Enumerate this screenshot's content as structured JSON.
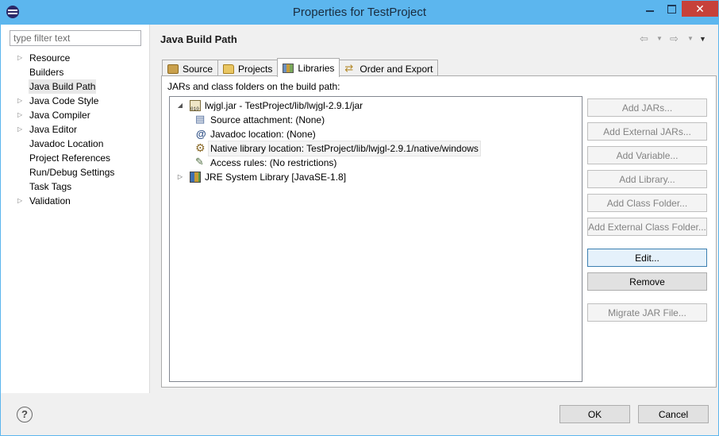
{
  "window": {
    "title": "Properties for TestProject",
    "close_glyph": "✕"
  },
  "filter": {
    "placeholder": "type filter text",
    "value": ""
  },
  "nav": {
    "items": [
      {
        "label": "Resource",
        "expandable": true
      },
      {
        "label": "Builders",
        "expandable": false
      },
      {
        "label": "Java Build Path",
        "expandable": false,
        "selected": true
      },
      {
        "label": "Java Code Style",
        "expandable": true
      },
      {
        "label": "Java Compiler",
        "expandable": true
      },
      {
        "label": "Java Editor",
        "expandable": true
      },
      {
        "label": "Javadoc Location",
        "expandable": false
      },
      {
        "label": "Project References",
        "expandable": false
      },
      {
        "label": "Run/Debug Settings",
        "expandable": false
      },
      {
        "label": "Task Tags",
        "expandable": false
      },
      {
        "label": "Validation",
        "expandable": true
      }
    ]
  },
  "page": {
    "title": "Java Build Path",
    "history": {
      "back": "⇦",
      "forward": "⇨",
      "dropdown": "▼",
      "menu": "▼"
    }
  },
  "tabs": [
    {
      "label": "Source",
      "icon": "source-folder-icon"
    },
    {
      "label": "Projects",
      "icon": "project-folder-icon"
    },
    {
      "label": "Libraries",
      "icon": "libraries-icon",
      "active": true
    },
    {
      "label": "Order and Export",
      "icon": "order-export-icon"
    }
  ],
  "libraries": {
    "heading": "JARs and class folders on the build path:",
    "tree": {
      "jar": {
        "label": "lwjgl.jar - TestProject/lib/lwjgl-2.9.1/jar",
        "expanded": true,
        "twisty": "◢",
        "children": [
          {
            "label": "Source attachment: (None)",
            "icon": "source-attachment-icon"
          },
          {
            "label": "Javadoc location: (None)",
            "icon": "javadoc-icon"
          },
          {
            "label": "Native library location: TestProject/lib/lwjgl-2.9.1/native/windows",
            "icon": "native-library-icon",
            "highlighted": true
          },
          {
            "label": "Access rules: (No restrictions)",
            "icon": "access-rules-icon"
          }
        ]
      },
      "jre": {
        "label": "JRE System Library [JavaSE-1.8]",
        "expanded": false,
        "twisty": "▷"
      }
    },
    "buttons": {
      "add_jars": "Add JARs...",
      "add_external_jars": "Add External JARs...",
      "add_variable": "Add Variable...",
      "add_library": "Add Library...",
      "add_class_folder": "Add Class Folder...",
      "add_external_class_folder": "Add External Class Folder...",
      "edit": "Edit...",
      "remove": "Remove",
      "migrate_jar": "Migrate JAR File..."
    }
  },
  "footer": {
    "help": "?",
    "ok": "OK",
    "cancel": "Cancel"
  },
  "colors": {
    "title_bar": "#5cb6ee",
    "close_button": "#c7413a",
    "dialog_bg": "#f0f0f0"
  }
}
